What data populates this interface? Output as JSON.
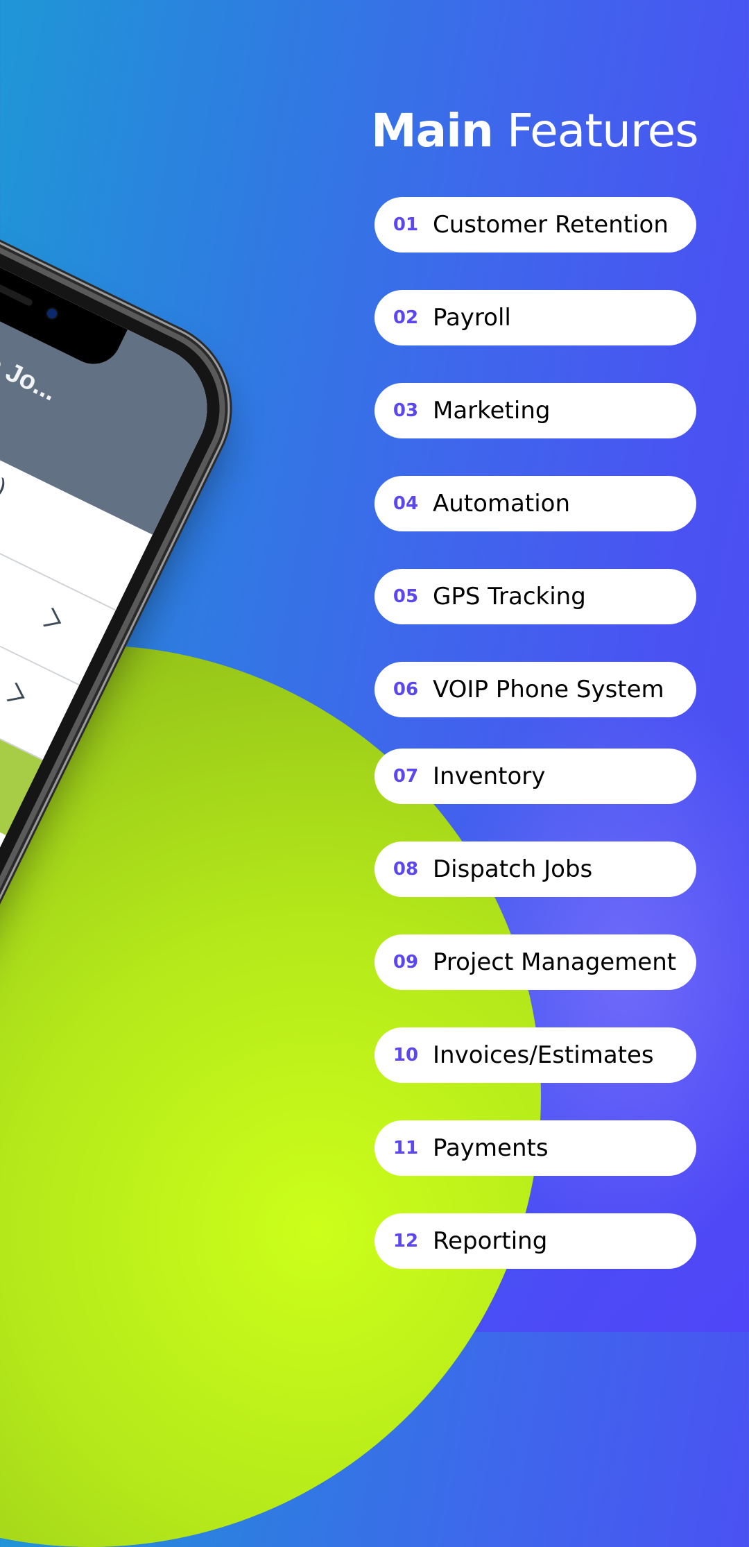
{
  "colors": {
    "accent_number": "#5a47f0",
    "background_start": "#1f97d6",
    "background_end": "#4e4cf4",
    "green_shape": "#ccff1a",
    "app_nav_bar": "#627184",
    "app_active_row": "#a6cd45"
  },
  "header": {
    "title_bold": "Main",
    "title_regular": "Features"
  },
  "features": [
    {
      "number": "01",
      "label": "Customer Retention"
    },
    {
      "number": "02",
      "label": "Payroll"
    },
    {
      "number": "03",
      "label": "Marketing"
    },
    {
      "number": "04",
      "label": "Automation"
    },
    {
      "number": "05",
      "label": "GPS Tracking"
    },
    {
      "number": "06",
      "label": "VOIP Phone System"
    },
    {
      "number": "07",
      "label": "Inventory"
    },
    {
      "number": "08",
      "label": "Dispatch Jobs"
    },
    {
      "number": "09",
      "label": "Project Management"
    },
    {
      "number": "10",
      "label": "Invoices/Estimates"
    },
    {
      "number": "11",
      "label": "Payments"
    },
    {
      "number": "12",
      "label": "Reporting"
    }
  ],
  "phone": {
    "nav_title": "Welcome Jo...",
    "user_label": "e(Employee)",
    "menu_rows": [
      {
        "icon": "chevron-right-icon",
        "active": false
      },
      {
        "icon": "chevron-right-icon",
        "active": false
      },
      {
        "icon": "chevron-right-icon",
        "active": true
      },
      {
        "icon": "chevron-right-icon",
        "active": false
      },
      {
        "icon": "chevron-right-icon",
        "active": false
      },
      {
        "icon": "chevron-right-icon",
        "active": false
      },
      {
        "icon": "chevron-right-icon",
        "active": false
      },
      {
        "icon": "chevron-right-icon",
        "active": false
      },
      {
        "icon": "chevron-right-icon",
        "active": false
      }
    ]
  }
}
